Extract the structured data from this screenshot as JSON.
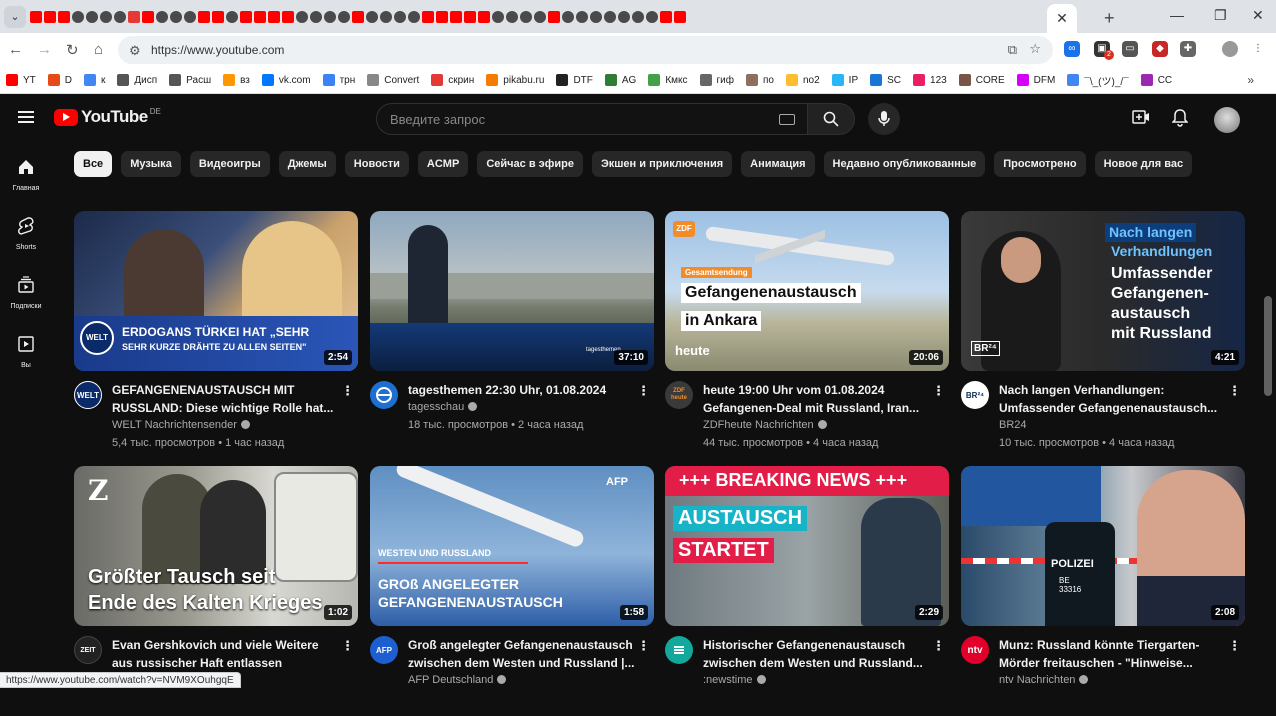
{
  "browser": {
    "tab_strip_favicons": [
      "yt",
      "yt",
      "yt",
      "g",
      "g",
      "g",
      "g",
      "a",
      "yt",
      "g",
      "g",
      "g",
      "yt",
      "yt",
      "g",
      "yt",
      "yt",
      "yt",
      "yt",
      "g",
      "g",
      "g",
      "g",
      "yt",
      "g",
      "g",
      "g",
      "g",
      "yt",
      "yt",
      "yt",
      "yt",
      "yt",
      "g",
      "g",
      "g",
      "g",
      "yt",
      "g",
      "g",
      "g",
      "g",
      "g",
      "g",
      "g",
      "yt",
      "yt"
    ],
    "active_tab_close": "✕",
    "new_tab": "+",
    "window_controls": {
      "minimize": "—",
      "maximize": "❐",
      "close": "✕"
    },
    "url": "https://www.youtube.com",
    "bookmarks": [
      {
        "label": "YT",
        "color": "#ff0000"
      },
      {
        "label": "D",
        "color": "#e64a19"
      },
      {
        "label": "к",
        "color": "#4285f4"
      },
      {
        "label": "Дисп",
        "color": "#555555"
      },
      {
        "label": "Расш",
        "color": "#555555"
      },
      {
        "label": "вз",
        "color": "#ff9800"
      },
      {
        "label": "vk.com",
        "color": "#0077ff"
      },
      {
        "label": "трн",
        "color": "#3b82f6"
      },
      {
        "label": "Convert",
        "color": "#888888"
      },
      {
        "label": "скрин",
        "color": "#e53935"
      },
      {
        "label": "pikabu.ru",
        "color": "#f57c00"
      },
      {
        "label": "DTF",
        "color": "#222222"
      },
      {
        "label": "AG",
        "color": "#2e7d32"
      },
      {
        "label": "Кмкс",
        "color": "#43a047"
      },
      {
        "label": "гиф",
        "color": "#666666"
      },
      {
        "label": "по",
        "color": "#8d6e63"
      },
      {
        "label": "no2",
        "color": "#fbc02d"
      },
      {
        "label": "IP",
        "color": "#29b6f6"
      },
      {
        "label": "SC",
        "color": "#1976d2"
      },
      {
        "label": "123",
        "color": "#e91e63"
      },
      {
        "label": "CORE",
        "color": "#795548"
      },
      {
        "label": "DFM",
        "color": "#d500f9"
      },
      {
        "label": "¯\\_(ツ)_/¯",
        "color": "#4285f4"
      },
      {
        "label": "CC",
        "color": "#9c27b0"
      }
    ],
    "bookmarks_more": "»",
    "status_url": "https://www.youtube.com/watch?v=NVM9XOuhgqE"
  },
  "youtube": {
    "logo_text": "YouTube",
    "region": "DE",
    "search_placeholder": "Введите запрос",
    "rail": [
      {
        "label": "Главная",
        "icon": "home-icon"
      },
      {
        "label": "Shorts",
        "icon": "shorts-icon"
      },
      {
        "label": "Подписки",
        "icon": "subscriptions-icon"
      },
      {
        "label": "Вы",
        "icon": "you-icon"
      }
    ],
    "chips": [
      "Все",
      "Музыка",
      "Видеоигры",
      "Джемы",
      "Новости",
      "ACMP",
      "Сейчас в эфире",
      "Экшен и приключения",
      "Анимация",
      "Недавно опубликованные",
      "Просмотрено",
      "Новое для вас"
    ],
    "videos": [
      {
        "title": "GEFANGENENAUSTAUSCH MIT RUSSLAND: Diese wichtige Rolle hat...",
        "channel": "WELT Nachrichtensender",
        "stats": "5,4 тыс. просмотров • 1 час назад",
        "duration": "2:54",
        "avatar_text": "WELT",
        "thumb_caption_1": "ERDOGANS TÜRKEI HAT „SEHR",
        "thumb_caption_2": "SEHR KURZE DRÄHTE ZU ALLEN SEITEN\"",
        "thumb_badge": "WELT"
      },
      {
        "title": "tagesthemen 22:30 Uhr, 01.08.2024",
        "channel": "tagesschau",
        "stats": "18 тыс. просмотров • 2 часа назад",
        "duration": "37:10",
        "avatar_text": "",
        "thumb_tag": "tagesthemen"
      },
      {
        "title": "heute 19:00 Uhr vom 01.08.2024 Gefangenen-Deal mit Russland, Iran...",
        "channel": "ZDFheute Nachrichten",
        "stats": "44 тыс. просмотров • 4 часа назад",
        "duration": "20:06",
        "avatar_text": "ZDF heute",
        "thumb_badge": "ZDF",
        "thumb_label": "Gesamtsendung",
        "thumb_line_1": "Gefangenenaustausch",
        "thumb_line_2": "in Ankara",
        "thumb_footer": "heute"
      },
      {
        "title": "Nach langen Verhandlungen: Umfassender Gefangenenaustausch...",
        "channel": "BR24",
        "stats": "10 тыс. просмотров • 4 часа назад",
        "duration": "4:21",
        "avatar_text": "BR²⁴",
        "thumb_sub_1": "Nach langen",
        "thumb_sub_2": "Verhandlungen",
        "thumb_main_1": "Umfassender",
        "thumb_main_2": "Gefangenen-",
        "thumb_main_3": "austausch",
        "thumb_main_4": "mit Russland",
        "thumb_badge": "BR²⁴"
      },
      {
        "title": "Evan Gershkovich und viele Weitere aus russischer Haft entlassen",
        "channel": "",
        "stats": "",
        "duration": "1:02",
        "avatar_text": "ZEIT",
        "thumb_logo": "Z",
        "thumb_line_1": "Größter Tausch seit",
        "thumb_line_2": "Ende des Kalten Krieges"
      },
      {
        "title": "Groß angelegter Gefangenenaustausch zwischen dem Westen und Russland |...",
        "channel": "AFP Deutschland",
        "stats": "",
        "duration": "1:58",
        "avatar_text": "AFP",
        "thumb_logo": "AFP",
        "thumb_label": "WESTEN UND RUSSLAND",
        "thumb_line_1": "GROß ANGELEGTER",
        "thumb_line_2": "GEFANGENENAUSTAUSCH"
      },
      {
        "title": "Historischer Gefangenenaustausch zwischen dem Westen und Russland...",
        "channel": ":newstime",
        "stats": "",
        "duration": "2:29",
        "avatar_text": "",
        "thumb_banner": "+++ BREAKING NEWS +++",
        "thumb_line_1": "AUSTAUSCH",
        "thumb_line_2": "STARTET"
      },
      {
        "title": "Munz: Russland könnte Tiergarten-Mörder freitauschen - \"Hinweise...",
        "channel": "ntv Nachrichten",
        "stats": "",
        "duration": "2:08",
        "avatar_text": "ntv",
        "thumb_vest": "POLIZEI",
        "thumb_vest_id": "BE 33316"
      }
    ]
  }
}
